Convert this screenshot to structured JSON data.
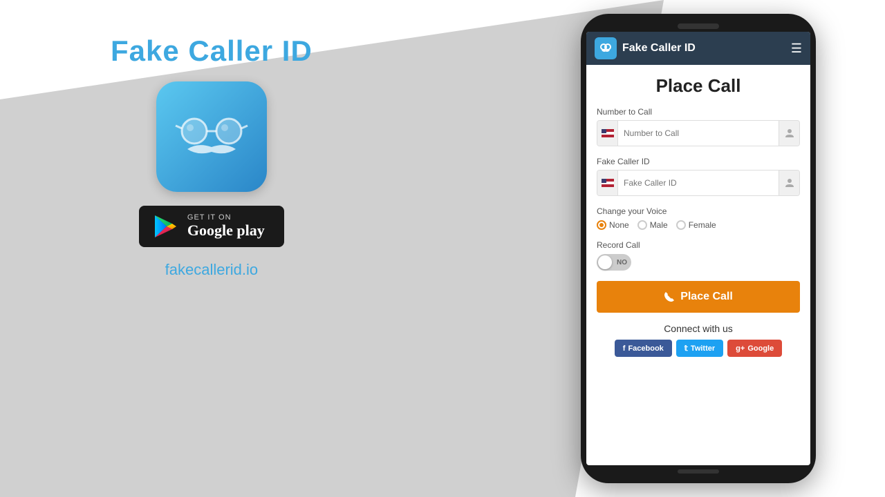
{
  "background": {
    "color": "#e0e0e0"
  },
  "left_panel": {
    "title": "Fake Caller ID",
    "google_play": {
      "get_it_on": "GET IT ON",
      "label": "Google play"
    },
    "website": "fakecallerid.io"
  },
  "phone": {
    "header": {
      "title": "Fake Caller ID",
      "menu_icon": "☰"
    },
    "content": {
      "page_title": "Place Call",
      "number_to_call_label": "Number to Call",
      "number_to_call_placeholder": "Number to Call",
      "fake_caller_id_label": "Fake Caller ID",
      "fake_caller_id_placeholder": "Fake Caller ID",
      "change_voice_label": "Change your Voice",
      "voice_options": [
        "None",
        "Male",
        "Female"
      ],
      "voice_selected": "None",
      "record_call_label": "Record Call",
      "record_toggle": "NO",
      "place_call_button": "Place Call",
      "connect_title": "Connect with us",
      "social_buttons": [
        {
          "label": "Facebook",
          "icon": "f"
        },
        {
          "label": "Twitter",
          "icon": "t"
        },
        {
          "label": "Google",
          "icon": "g+"
        }
      ]
    }
  }
}
